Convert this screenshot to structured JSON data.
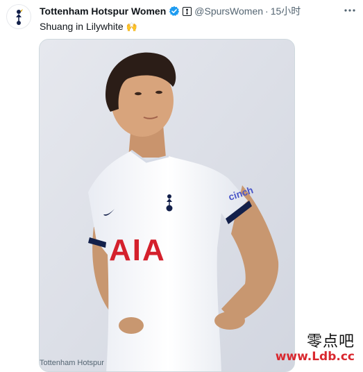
{
  "tweet": {
    "display_name": "Tottenham Hotspur Women",
    "handle": "@SpursWomen",
    "separator": "·",
    "time": "15小时",
    "text": "Shuang in Lilywhite",
    "emoji": "🙌",
    "media_caption": "Tottenham Hotspur",
    "shirt_sponsor": "AIA",
    "sleeve_sponsor": "cinch"
  },
  "watermark": {
    "chinese": "零点吧",
    "url": "www.Ldb.cc"
  },
  "colors": {
    "verified": "#1d9bf0",
    "sponsor_red": "#d4202c",
    "navy": "#13204a"
  }
}
